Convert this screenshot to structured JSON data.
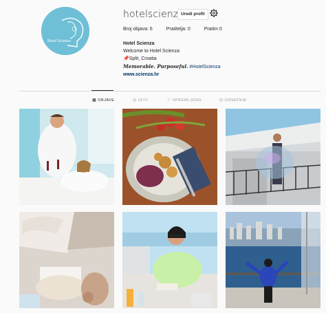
{
  "profile": {
    "username": "hotelscienza",
    "edit_label": "Uredi profil",
    "avatar_text": "Hotel Scienza",
    "stats": {
      "posts": "Broj objava: 6",
      "followers": "Pratitelja: 0",
      "following": "Pratim 0"
    },
    "bio": {
      "name": "Hotel Scienza",
      "welcome": "Welcome to Hotel Scienza",
      "location": "📌Split, Croatia",
      "motto": "𝑴𝒆𝒎𝒐𝒓𝒂𝒃𝒍𝒆. 𝑷𝒖𝒓𝒑𝒐𝒔𝒆𝒇𝒖𝒍.",
      "hashtag": "#HotelScienza",
      "website": "www.scienza.hr"
    }
  },
  "tabs": [
    {
      "label": "OBJAVE",
      "icon": "grid-icon",
      "active": true
    },
    {
      "label": "IGTV",
      "icon": "igtv-icon",
      "active": false
    },
    {
      "label": "SPREMLJENO",
      "icon": "bookmark-icon",
      "active": false
    },
    {
      "label": "OZNAČENI",
      "icon": "tagged-icon",
      "active": false
    }
  ],
  "posts": [
    {
      "icon": "couple-spa-photo"
    },
    {
      "icon": "food-plate-photo"
    },
    {
      "icon": "bubble-balcony-photo"
    },
    {
      "icon": "towels-spa-photo"
    },
    {
      "icon": "woman-coffee-photo"
    },
    {
      "icon": "man-seaside-photo"
    }
  ]
}
